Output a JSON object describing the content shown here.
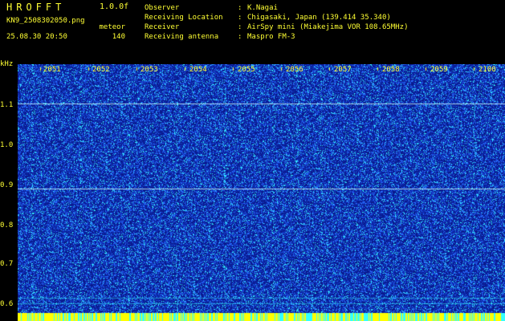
{
  "header": {
    "app_title": "HROFFT",
    "version": "1.0.0f",
    "filename": "KN9_2508302050.png",
    "datetime": "25.08.30 20:50",
    "meteor_label": "meteor",
    "meteor_count": "140"
  },
  "info": [
    {
      "label": "Observer",
      "value": "K.Nagai"
    },
    {
      "label": "Receiving Location",
      "value": "Chigasaki, Japan (139.414 35.340)"
    },
    {
      "label": "Receiver",
      "value": "AirSpy mini (Miakejima VOR 108.65MHz)"
    },
    {
      "label": "Receiving antenna",
      "value": "Maspro FM-3"
    }
  ],
  "plot": {
    "unit_label": "kHz",
    "y_ticks": [
      "1.1",
      "1.0",
      "0.9",
      "0.8",
      "0.7",
      "0.6"
    ],
    "x_ticks": [
      "2051",
      "2052",
      "2053",
      "2054",
      "2055",
      "2056",
      "2057",
      "2058",
      "2059",
      "2100"
    ],
    "colors": {
      "background": "#000000",
      "spectrum_base": "#0a1a8c",
      "noise_high": "#33ffff",
      "noise_mid": "#2a6aff",
      "grid_line": "#ffffff",
      "bottom_bar": "#ffff00",
      "text": "#ffff33"
    }
  }
}
